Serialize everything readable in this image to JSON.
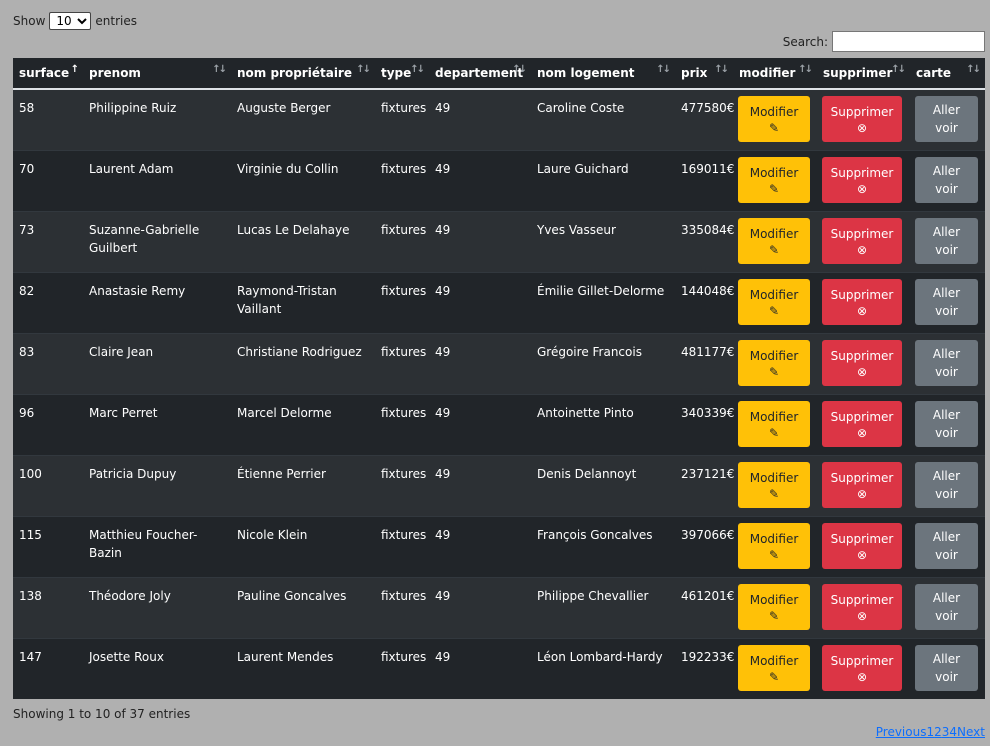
{
  "length": {
    "show": "Show",
    "value": "10",
    "entries": "entries"
  },
  "search": {
    "label": "Search:",
    "value": ""
  },
  "columns": [
    "surface",
    "prenom",
    "nom propriétaire",
    "type",
    "departement",
    "nom logement",
    "prix",
    "modifier",
    "supprimer",
    "carte"
  ],
  "rows": [
    {
      "surface": "58",
      "prenom": "Philippine Ruiz",
      "proprietaire": "Auguste Berger",
      "type": "fixtures",
      "departement": "49",
      "logement": "Caroline Coste",
      "prix": "477580€"
    },
    {
      "surface": "70",
      "prenom": "Laurent Adam",
      "proprietaire": "Virginie du Collin",
      "type": "fixtures",
      "departement": "49",
      "logement": "Laure Guichard",
      "prix": "169011€"
    },
    {
      "surface": "73",
      "prenom": "Suzanne-Gabrielle Guilbert",
      "proprietaire": "Lucas Le Delahaye",
      "type": "fixtures",
      "departement": "49",
      "logement": "Yves Vasseur",
      "prix": "335084€"
    },
    {
      "surface": "82",
      "prenom": "Anastasie Remy",
      "proprietaire": "Raymond-Tristan Vaillant",
      "type": "fixtures",
      "departement": "49",
      "logement": "Émilie Gillet-Delorme",
      "prix": "144048€"
    },
    {
      "surface": "83",
      "prenom": "Claire Jean",
      "proprietaire": "Christiane Rodriguez",
      "type": "fixtures",
      "departement": "49",
      "logement": "Grégoire Francois",
      "prix": "481177€"
    },
    {
      "surface": "96",
      "prenom": "Marc Perret",
      "proprietaire": "Marcel Delorme",
      "type": "fixtures",
      "departement": "49",
      "logement": "Antoinette Pinto",
      "prix": "340339€"
    },
    {
      "surface": "100",
      "prenom": "Patricia Dupuy",
      "proprietaire": "Étienne Perrier",
      "type": "fixtures",
      "departement": "49",
      "logement": "Denis Delannoyt",
      "prix": "237121€"
    },
    {
      "surface": "115",
      "prenom": "Matthieu Foucher-Bazin",
      "proprietaire": "Nicole Klein",
      "type": "fixtures",
      "departement": "49",
      "logement": "François Goncalves",
      "prix": "397066€"
    },
    {
      "surface": "138",
      "prenom": "Théodore Joly",
      "proprietaire": "Pauline Goncalves",
      "type": "fixtures",
      "departement": "49",
      "logement": "Philippe Chevallier",
      "prix": "461201€"
    },
    {
      "surface": "147",
      "prenom": "Josette Roux",
      "proprietaire": "Laurent Mendes",
      "type": "fixtures",
      "departement": "49",
      "logement": "Léon Lombard-Hardy",
      "prix": "192233€"
    }
  ],
  "buttons": {
    "modifier": "Modifier",
    "supprimer": "Supprimer",
    "carte_line1": "Aller",
    "carte_line2": "voir"
  },
  "icons": {
    "modifier": "edit-icon",
    "supprimer": "circle-x-icon",
    "sort": "sort-arrows-icon"
  },
  "colors": {
    "modifier": "#ffc107",
    "supprimer": "#dc3545",
    "carte": "#6c757d",
    "table_bg": "#212529"
  },
  "info": "Showing 1 to 10 of 37 entries",
  "pagination": [
    "Previous",
    "1",
    "2",
    "3",
    "4",
    "Next"
  ]
}
